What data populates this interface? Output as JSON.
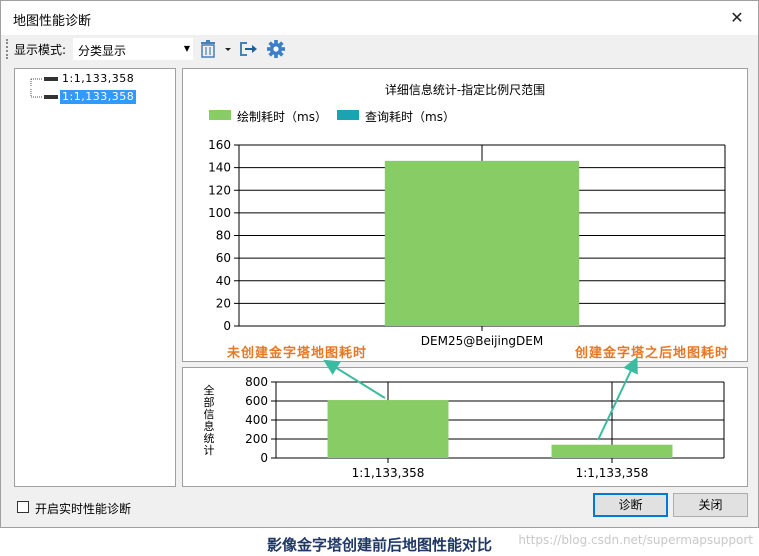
{
  "window": {
    "title": "地图性能诊断",
    "close_glyph": "✕"
  },
  "toolbar": {
    "mode_label": "显示模式:",
    "mode_value": "分类显示",
    "icons": [
      "trash-icon",
      "chevron-down-icon",
      "export-icon",
      "gear-icon"
    ]
  },
  "tree": {
    "items": [
      {
        "label": "1:1,133,358",
        "selected": false
      },
      {
        "label": "1:1,133,358",
        "selected": true
      }
    ]
  },
  "colors": {
    "draw_series": "#88cc66",
    "query_series": "#1aa3b0",
    "annotation": "#e87722",
    "arrow": "#3bbca0",
    "selection": "#3399ff",
    "caption": "#1f3864"
  },
  "chart_data": [
    {
      "type": "bar",
      "title": "详细信息统计-指定比例尺范围",
      "legend_position": "top-left",
      "series": [
        {
          "name": "绘制耗时（ms）",
          "values": [
            146
          ]
        },
        {
          "name": "查询耗时（ms）",
          "values": [
            0
          ]
        }
      ],
      "categories": [
        "DEM25@BeijingDEM"
      ],
      "ylim": [
        0,
        160
      ],
      "yticks": [
        0,
        20,
        40,
        60,
        80,
        100,
        120,
        140,
        160
      ],
      "grid": true
    },
    {
      "type": "bar",
      "ylabel": "全部信息统计",
      "categories": [
        "1:1,133,358",
        "1:1,133,358"
      ],
      "series": [
        {
          "values": [
            610,
            140
          ]
        }
      ],
      "ylim": [
        0,
        800
      ],
      "yticks": [
        0,
        200,
        400,
        600,
        800
      ],
      "grid": true
    }
  ],
  "annotations": {
    "before": "未创建金字塔地图耗时",
    "after": "创建金字塔之后地图耗时"
  },
  "footer": {
    "checkbox_label": "开启实时性能诊断",
    "diagnose_button": "诊断",
    "close_button": "关闭"
  },
  "caption": "影像金字塔创建前后地图性能对比",
  "watermark": "https://blog.csdn.net/supermapsupport"
}
